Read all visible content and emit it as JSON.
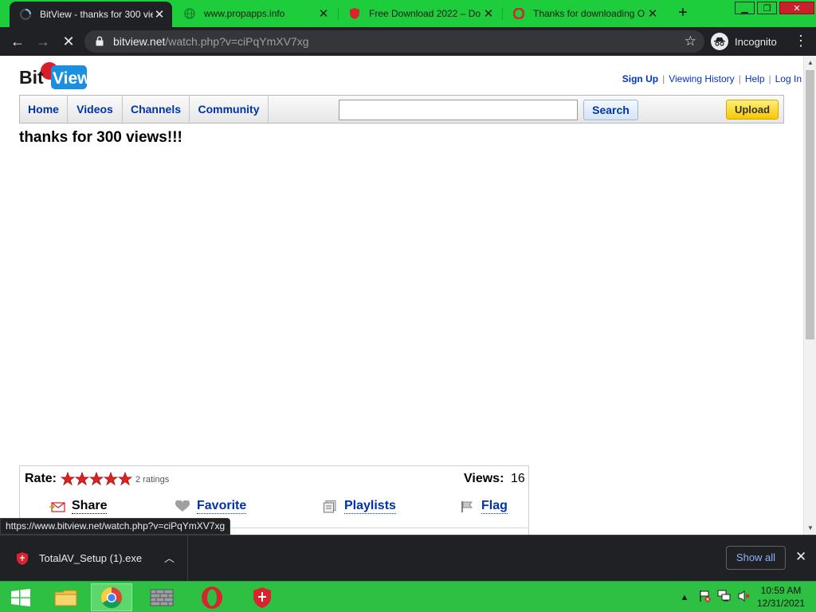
{
  "browser": {
    "tabs": [
      {
        "title": "BitView - thanks for 300 views!!!",
        "active": true
      },
      {
        "title": "www.propapps.info",
        "active": false
      },
      {
        "title": "Free Download 2022 – Do",
        "active": false
      },
      {
        "title": "Thanks for downloading O",
        "active": false
      }
    ],
    "url_host": "bitview.net",
    "url_path": "/watch.php?v=ciPqYmXV7xg",
    "incognito_label": "Incognito"
  },
  "site": {
    "logo_text_left": "Bit",
    "logo_text_right": "View",
    "top_links": [
      "Sign Up",
      "Viewing History",
      "Help",
      "Log In"
    ],
    "nav": [
      "Home",
      "Videos",
      "Channels",
      "Community"
    ],
    "search_value": "",
    "search_button": "Search",
    "upload_button": "Upload",
    "video_title": "thanks for 300 views!!!",
    "rate_label": "Rate:",
    "rating_stars": 5,
    "ratings_count": "2 ratings",
    "views_label": "Views:",
    "views_value": "16",
    "actions": {
      "share": "Share",
      "favorite": "Favorite",
      "playlists": "Playlists",
      "flag": "Flag"
    }
  },
  "status_bubble": "https://www.bitview.net/watch.php?v=ciPqYmXV7xg",
  "download_shelf": {
    "file_name": "TotalAV_Setup (1).exe",
    "show_all": "Show all"
  },
  "taskbar": {
    "time": "10:59 AM",
    "date": "12/31/2021"
  },
  "colors": {
    "taskbar_green": "#2ec043",
    "tab_strip_green": "#1ecd3c",
    "link_blue": "#0033cc",
    "star_red": "#e02020",
    "upload_yellow": "#f8c700"
  }
}
